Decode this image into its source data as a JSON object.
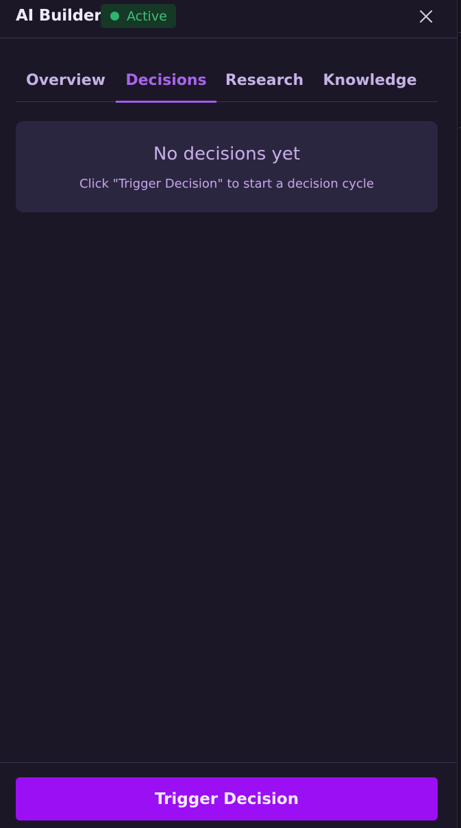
{
  "header": {
    "title": "AI Builder",
    "status_label": "Active",
    "status_color": "#2fb470"
  },
  "tabs": [
    {
      "label": "Overview",
      "active": false
    },
    {
      "label": "Decisions",
      "active": true
    },
    {
      "label": "Research",
      "active": false
    },
    {
      "label": "Knowledge",
      "active": false
    }
  ],
  "empty_state": {
    "title": "No decisions yet",
    "subtitle": "Click \"Trigger Decision\" to start a decision cycle"
  },
  "footer": {
    "button_label": "Trigger Decision"
  },
  "colors": {
    "accent": "#a865ec",
    "primary_button": "#9b0ff4",
    "background": "#1b1727"
  },
  "icons": {
    "close": "close-icon",
    "status": "status-dot-icon"
  }
}
